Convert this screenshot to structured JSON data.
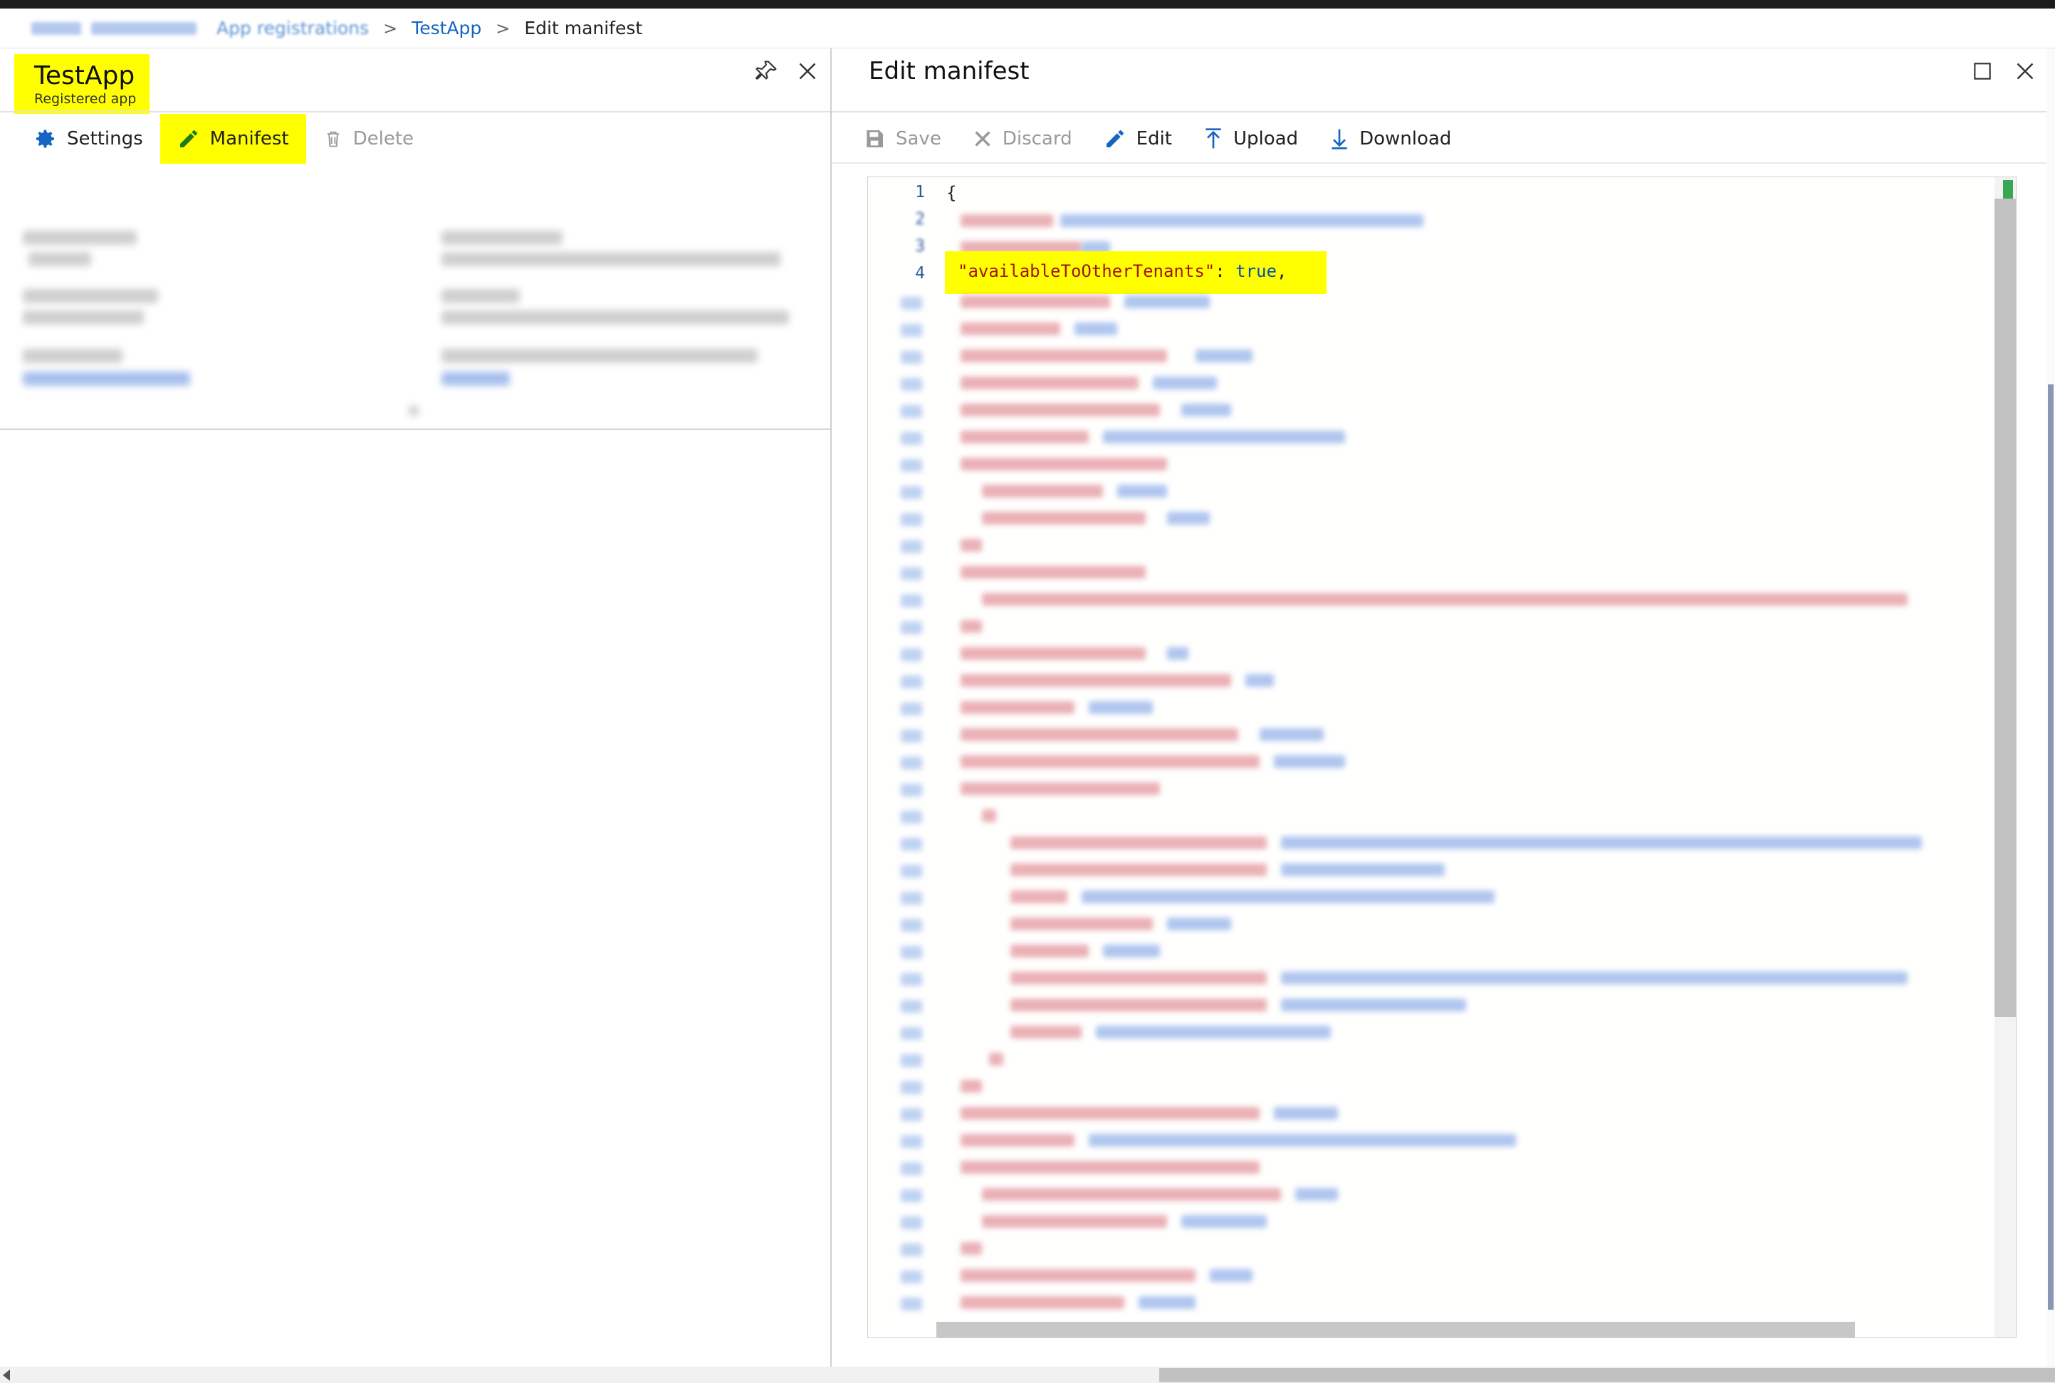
{
  "breadcrumb": {
    "items": [
      "App registrations",
      "TestApp",
      "Edit manifest"
    ]
  },
  "left_blade": {
    "title": "TestApp",
    "subtitle": "Registered app",
    "toolbar": {
      "settings_label": "Settings",
      "manifest_label": "Manifest",
      "delete_label": "Delete"
    }
  },
  "right_blade": {
    "title": "Edit manifest",
    "toolbar": {
      "save_label": "Save",
      "discard_label": "Discard",
      "edit_label": "Edit",
      "upload_label": "Upload",
      "download_label": "Download"
    }
  },
  "editor": {
    "line_numbers": [
      "1",
      "2",
      "3",
      "4"
    ],
    "line1": "{",
    "line4_key": "\"availableToOtherTenants\"",
    "line4_sep": ": ",
    "line4_value": "true",
    "line4_end": ","
  },
  "colors": {
    "highlight": "#ffff00",
    "accent": "#1565c0",
    "json_key": "#a31515",
    "json_value": "#0451a5"
  },
  "icons": [
    "gear-icon",
    "pencil-icon",
    "trash-icon",
    "pin-icon",
    "close-icon",
    "maximize-icon",
    "save-icon",
    "discard-icon",
    "upload-icon",
    "download-icon"
  ]
}
